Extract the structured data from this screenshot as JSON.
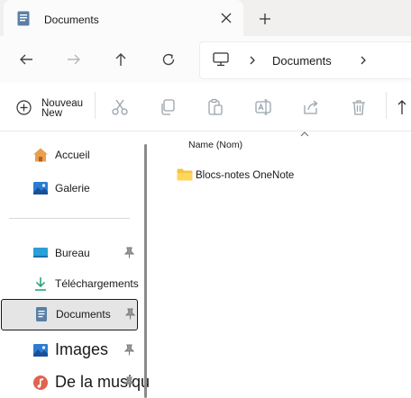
{
  "tab": {
    "title": "Documents"
  },
  "address": {
    "crumb": "Documents"
  },
  "toolbar": {
    "new_label_top": "Nouveau",
    "new_label_bottom": "New"
  },
  "sidebar": {
    "items": [
      {
        "label": "Accueil",
        "icon": "home-icon"
      },
      {
        "label": "Galerie",
        "icon": "gallery-icon"
      },
      {
        "label": "Bureau",
        "icon": "desktop-icon",
        "pinned": true
      },
      {
        "label": "Téléchargements",
        "icon": "download-icon",
        "pinned": true
      },
      {
        "label": "Documents",
        "icon": "documents-icon",
        "pinned": true,
        "selected": true
      },
      {
        "label": "Images",
        "icon": "pictures-icon",
        "pinned": true
      },
      {
        "label": "De la musique",
        "icon": "music-icon",
        "pinned": true
      }
    ]
  },
  "content": {
    "column_header": "Name (Nom)",
    "rows": [
      {
        "name": "Blocs-notes OneNote",
        "icon": "folder-icon"
      }
    ]
  },
  "colors": {
    "accent": "#0067c0",
    "folder": "#f4c542",
    "selection_bg": "#e5e5e5"
  }
}
